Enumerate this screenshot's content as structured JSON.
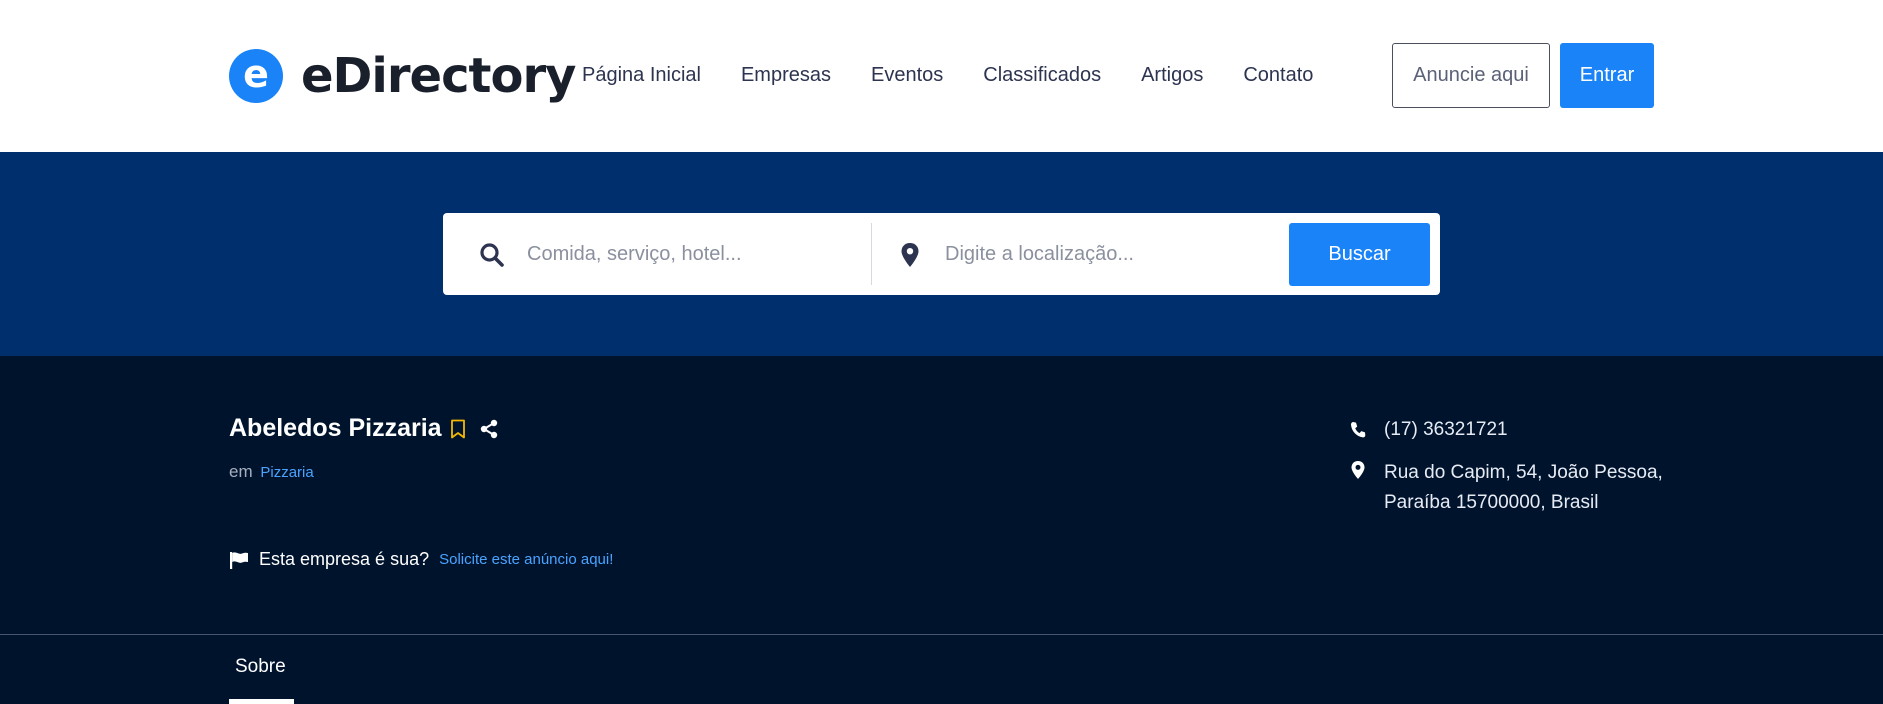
{
  "header": {
    "logo_mark": "e",
    "logo_text": "eDirectory",
    "nav": [
      {
        "label": "Página Inicial"
      },
      {
        "label": "Empresas"
      },
      {
        "label": "Eventos"
      },
      {
        "label": "Classificados"
      },
      {
        "label": "Artigos"
      },
      {
        "label": "Contato"
      }
    ],
    "advertise_label": "Anuncie aqui",
    "login_label": "Entrar"
  },
  "search": {
    "keyword_placeholder": "Comida, serviço, hotel...",
    "location_placeholder": "Digite a localização...",
    "button_label": "Buscar"
  },
  "listing": {
    "title": "Abeledos Pizzaria",
    "category_prefix": "em",
    "category": "Pizzaria",
    "claim_text": "Esta empresa é sua?",
    "claim_link": "Solicite este anúncio aqui!",
    "phone": "(17) 36321721",
    "address": "Rua do Capim, 54, João Pessoa, Paraíba 15700000, Brasil"
  },
  "tabs": [
    {
      "label": "Sobre",
      "active": true
    }
  ],
  "colors": {
    "brand_blue": "#1a83f7",
    "search_band": "#002f6d",
    "listing_bg": "#00132d",
    "bookmark": "#f5b800",
    "link": "#4aa3ff"
  }
}
